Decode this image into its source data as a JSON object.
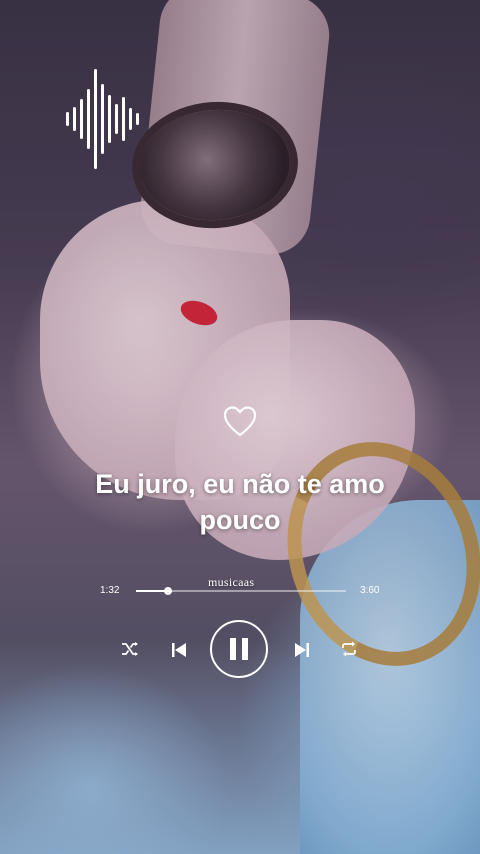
{
  "lyrics": {
    "line1": "Eu juro, eu não te amo",
    "line2": "pouco"
  },
  "player": {
    "watermark": "musicaas",
    "current_time": "1:32",
    "total_time": "3:60",
    "progress": 0.15
  },
  "icons": {
    "waveform": "waveform-icon",
    "heart": "heart-outline-icon",
    "shuffle": "shuffle-icon",
    "previous": "skip-previous-icon",
    "pause": "pause-icon",
    "next": "skip-next-icon",
    "repeat": "repeat-icon"
  },
  "colors": {
    "accent": "#ffffff",
    "nail": "#d9253a"
  }
}
